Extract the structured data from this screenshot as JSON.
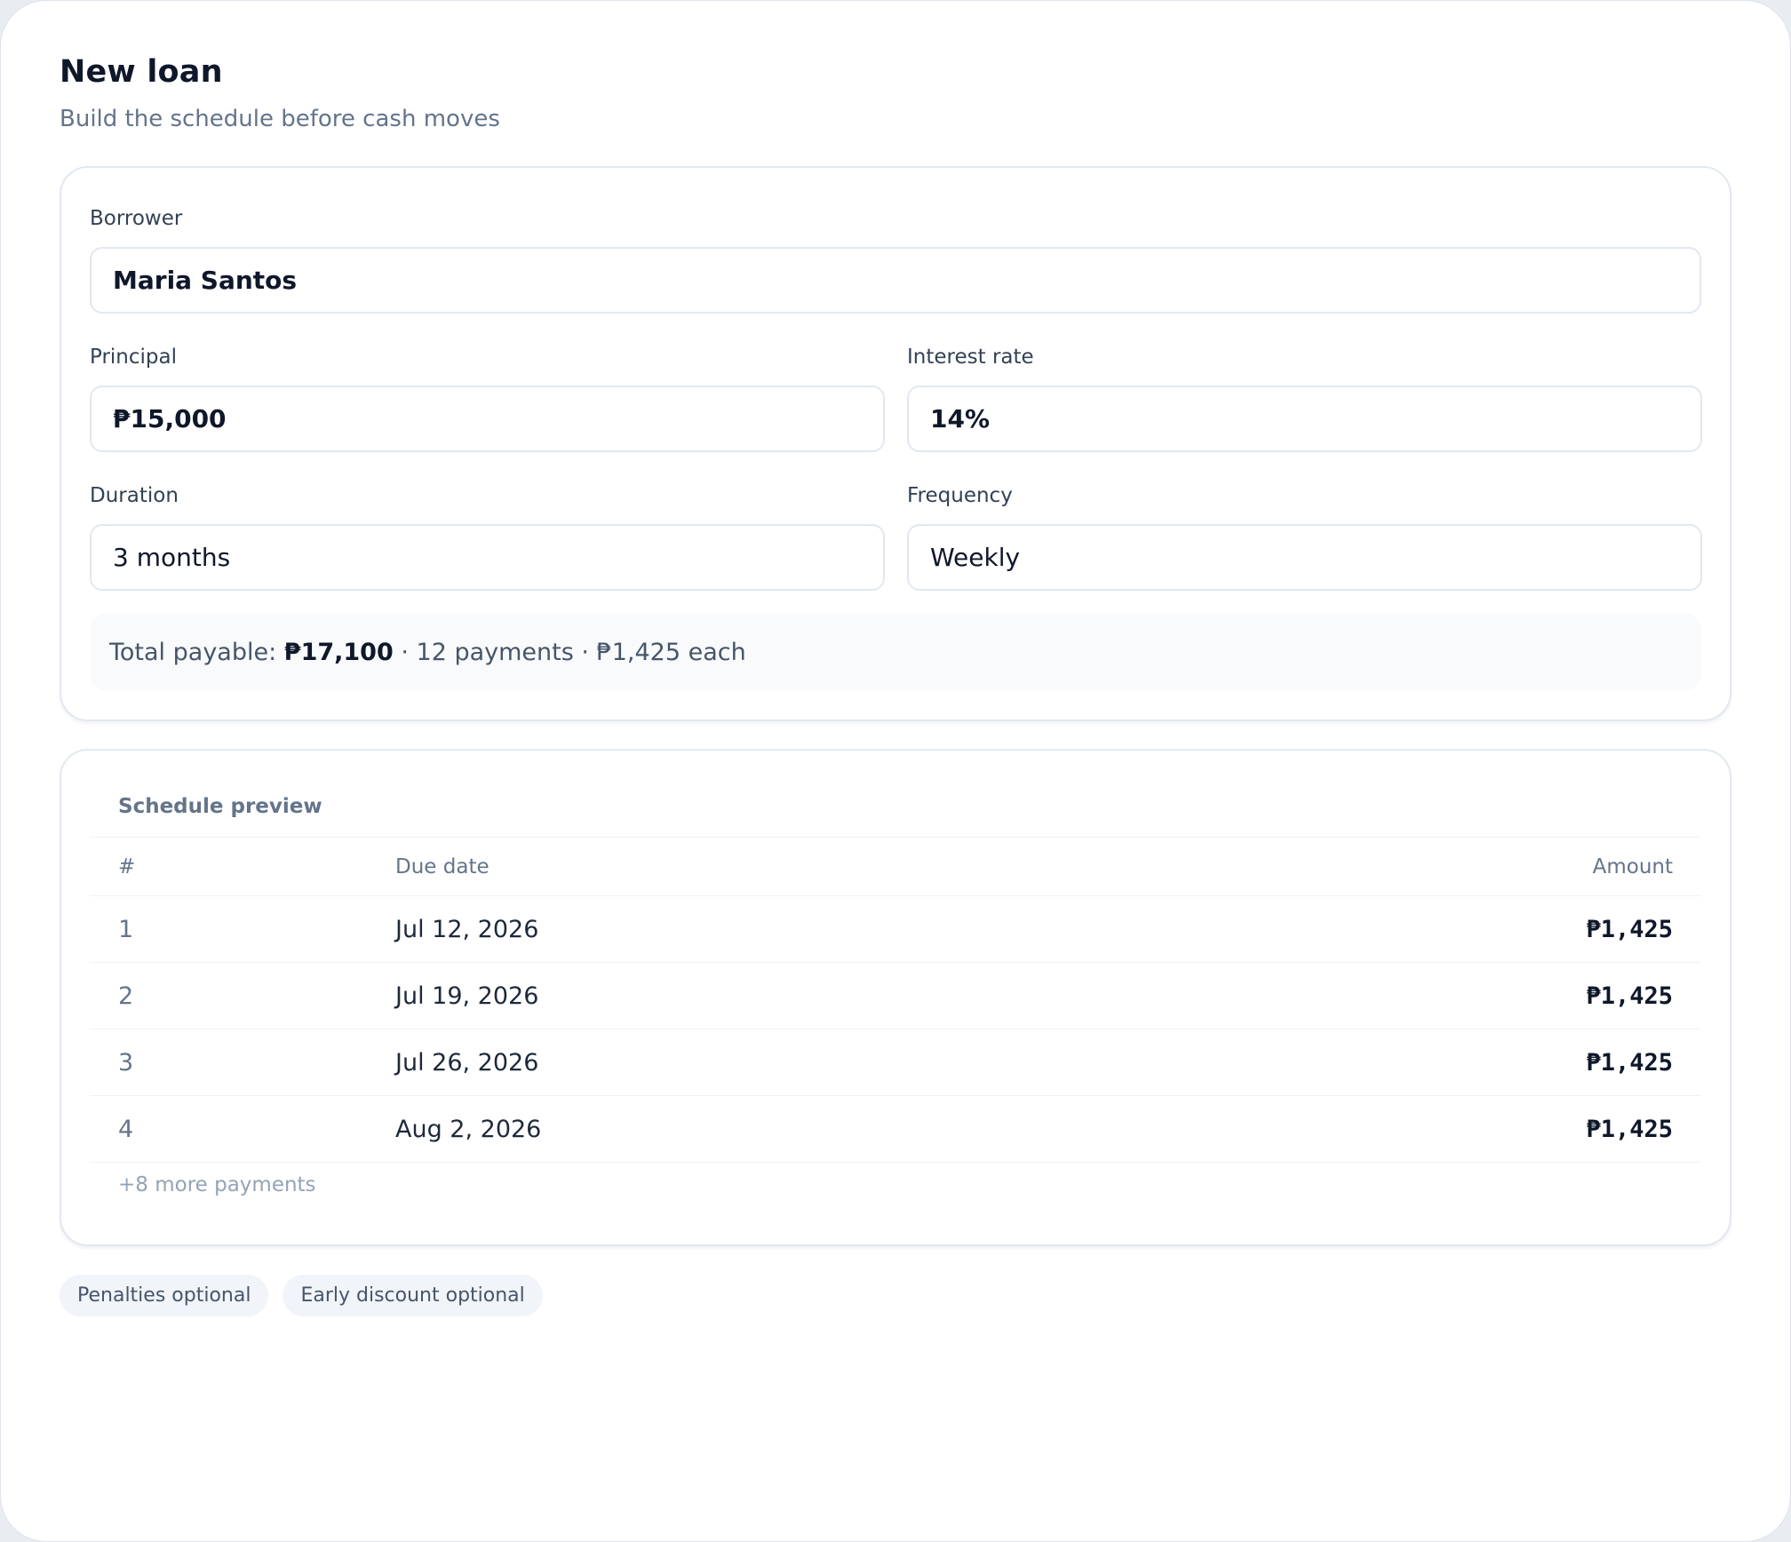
{
  "header": {
    "title": "New loan",
    "subtitle": "Build the schedule before cash moves"
  },
  "form": {
    "borrower": {
      "label": "Borrower",
      "value": "Maria Santos"
    },
    "principal": {
      "label": "Principal",
      "value": "₱15,000"
    },
    "interest_rate": {
      "label": "Interest rate",
      "value": "14%"
    },
    "duration": {
      "label": "Duration",
      "value": "3 months"
    },
    "frequency": {
      "label": "Frequency",
      "value": "Weekly"
    }
  },
  "summary": {
    "prefix": "Total payable: ",
    "total": "₱17,100",
    "details": " · 12 payments · ₱1,425 each"
  },
  "schedule": {
    "title": "Schedule preview",
    "columns": {
      "number": "#",
      "due_date": "Due date",
      "amount": "Amount"
    },
    "rows": [
      {
        "number": "1",
        "due_date": "Jul 12, 2026",
        "amount": "₱1,425"
      },
      {
        "number": "2",
        "due_date": "Jul 19, 2026",
        "amount": "₱1,425"
      },
      {
        "number": "3",
        "due_date": "Jul 26, 2026",
        "amount": "₱1,425"
      },
      {
        "number": "4",
        "due_date": "Aug 2, 2026",
        "amount": "₱1,425"
      }
    ],
    "more_label": "+8 more payments"
  },
  "chips": [
    {
      "label": "Penalties optional"
    },
    {
      "label": "Early discount optional"
    }
  ]
}
